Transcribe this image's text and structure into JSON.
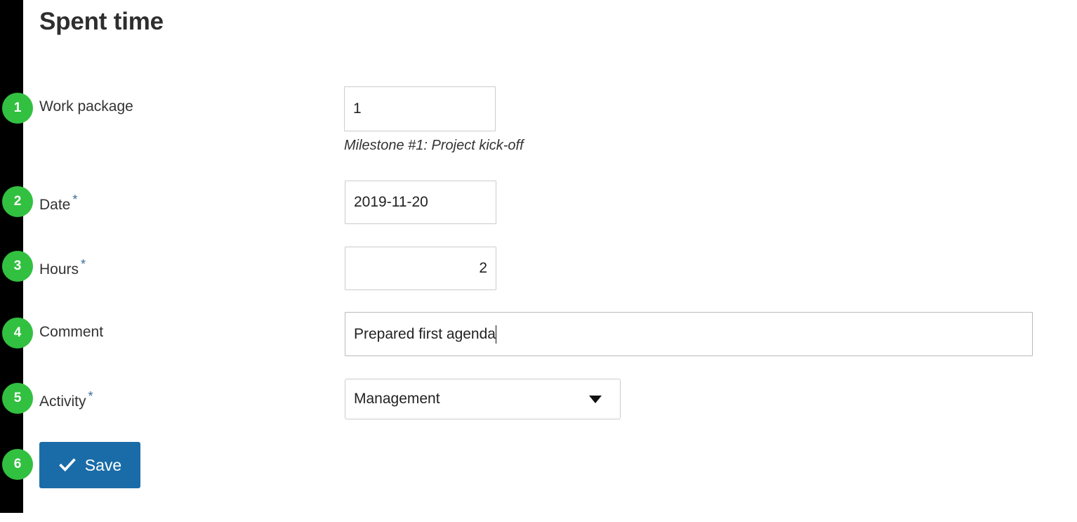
{
  "page": {
    "title": "Spent time",
    "background_color": "#ffffff",
    "rail_color": "#000000",
    "badge_color": "#32c040",
    "primary_button_color": "#1a6ca8",
    "required_marker": "*"
  },
  "fields": [
    {
      "step": "1",
      "label": "Work package",
      "required": false,
      "value": "1",
      "helper": "Milestone #1: Project kick-off"
    },
    {
      "step": "2",
      "label": "Date",
      "required": true,
      "value": "2019-11-20"
    },
    {
      "step": "3",
      "label": "Hours",
      "required": true,
      "value": "2"
    },
    {
      "step": "4",
      "label": "Comment",
      "required": false,
      "value": "Prepared first agenda"
    },
    {
      "step": "5",
      "label": "Activity",
      "required": true,
      "value": "Management",
      "icon": "chevron-down-icon"
    }
  ],
  "actions": {
    "step": "6",
    "save_label": "Save",
    "save_icon": "check-icon"
  }
}
